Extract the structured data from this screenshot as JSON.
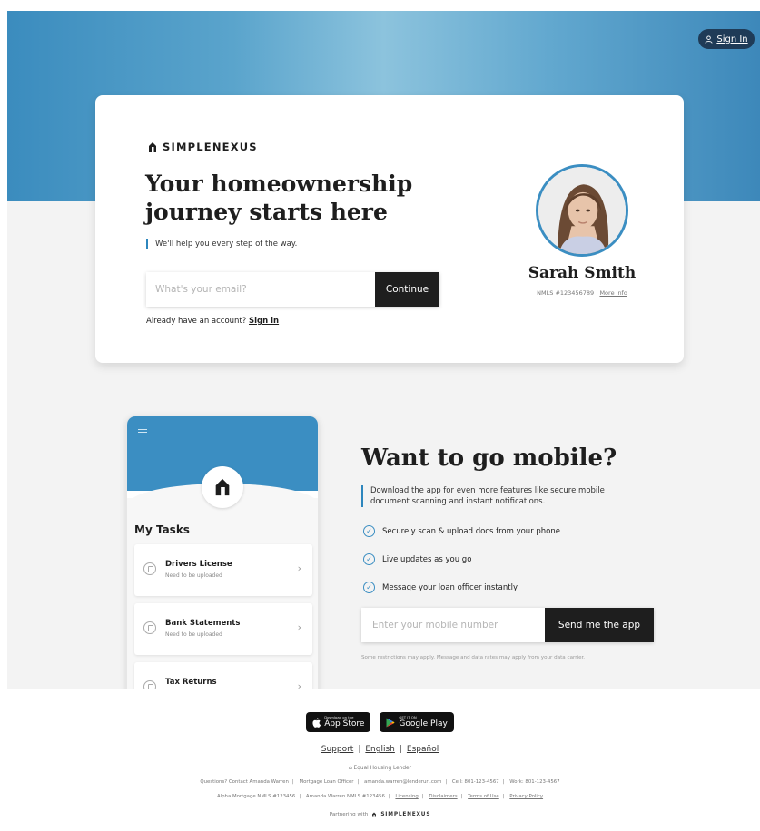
{
  "header": {
    "sign_in_label": "Sign In"
  },
  "hero": {
    "brand": "SIMPLENEXUS",
    "headline": "Your homeownership journey starts here",
    "tagline": "We'll help you every step of the way.",
    "email_placeholder": "What's your email?",
    "continue_label": "Continue",
    "already_text": "Already have an account?",
    "signin_link": "Sign in"
  },
  "loan_officer": {
    "name": "Sarah Smith",
    "nmls": "NMLS #123456789",
    "more_info": "More info"
  },
  "phone_mockup": {
    "tasks_title": "My Tasks",
    "tasks": [
      {
        "name": "Drivers License",
        "status": "Need to be uploaded"
      },
      {
        "name": "Bank Statements",
        "status": "Need to be uploaded"
      },
      {
        "name": "Tax Returns",
        "status": ""
      }
    ]
  },
  "mobile": {
    "title": "Want to go mobile?",
    "description": "Download the app for even more features like secure mobile document scanning and instant notifications.",
    "features": [
      "Securely scan & upload docs from your phone",
      "Live updates as you go",
      "Message your loan officer instantly"
    ],
    "phone_placeholder": "Enter your mobile number",
    "send_label": "Send me the app",
    "disclaimer": "Some restrictions may apply. Message and data rates may apply from your data carrier."
  },
  "footer": {
    "app_store": {
      "small": "Download on the",
      "big": "App Store"
    },
    "google_play": {
      "small": "GET IT ON",
      "big": "Google Play"
    },
    "links": [
      "Support",
      "English",
      "Español"
    ],
    "equal_housing": "Equal Housing Lender",
    "contact": [
      "Questions? Contact Amanda Warren",
      "Mortgage Loan Officer",
      "amanda.warren@lenderurl.com",
      "Cell: 801-123-4567",
      "Work: 801-123-4567"
    ],
    "legal_text": [
      "Alpha Mortgage NMLS #123456",
      "Amanda Warren NMLS #123456"
    ],
    "legal_links": [
      "Licensing",
      "Disclaimers",
      "Terms of Use",
      "Privacy Policy"
    ],
    "partner_text": "Partnering with",
    "partner_brand": "SIMPLENEXUS"
  },
  "colors": {
    "brand_blue": "#3b8ec2",
    "dark": "#1e1e1e",
    "navy_pill": "#1f3b57"
  }
}
